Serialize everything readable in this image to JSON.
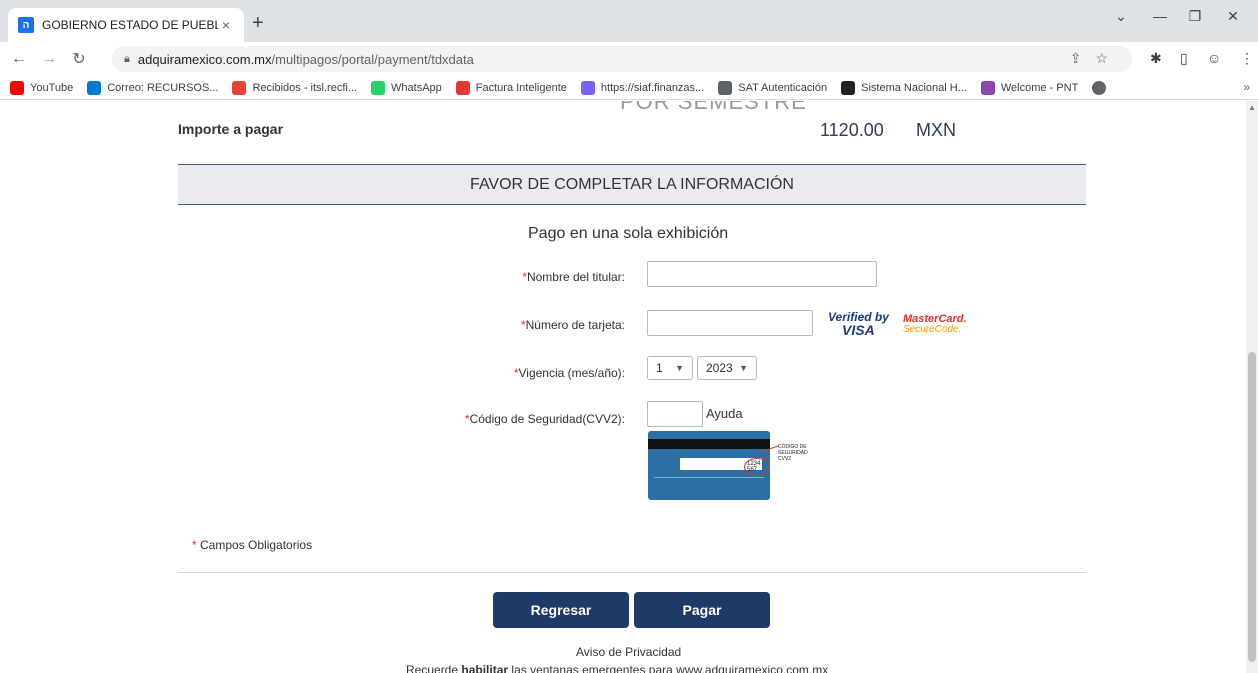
{
  "browser": {
    "tab_title": "GOBIERNO ESTADO DE PUEBLA",
    "tab_close": "×",
    "new_tab": "+",
    "url_domain": "adquiramexico.com.mx",
    "url_path": "/multipagos/portal/payment/tdxdata",
    "window_min": "—",
    "window_restore": "❐",
    "window_close": "✕",
    "window_dropdown": "⌄",
    "bookmarks": [
      {
        "label": "YouTube",
        "color": "#ff0000"
      },
      {
        "label": "Correo: RECURSOS...",
        "color": "#0078d4"
      },
      {
        "label": "Recibidos - itsl.recfi...",
        "color": "#ea4335"
      },
      {
        "label": "WhatsApp",
        "color": "#25d366"
      },
      {
        "label": "Factura Inteligente",
        "color": "#e53935"
      },
      {
        "label": "https://siaf.finanzas...",
        "color": "#7b61ff"
      },
      {
        "label": "SAT Autenticación",
        "color": "#5f6368"
      },
      {
        "label": "Sistema Nacional H...",
        "color": "#202124"
      },
      {
        "label": "Welcome - PNT",
        "color": "#8e44ad"
      }
    ],
    "bookmarks_more": "»"
  },
  "page": {
    "cut_heading": "POR SEMESTRE",
    "importe_label": "Importe a pagar",
    "importe_amount": "1120.00",
    "importe_currency": "MXN",
    "section_title": "FAVOR DE COMPLETAR LA INFORMACIÓN",
    "pay_mode": "Pago en una sola exhibición",
    "required_mark": "*",
    "fields": {
      "nombre_label": "Nombre del titular:",
      "nombre_value": "",
      "tarjeta_label": "Número de tarjeta:",
      "tarjeta_value": "",
      "vigencia_label": "Vigencia (mes/año):",
      "vigencia_month": "1",
      "vigencia_year": "2023",
      "cvv_label": "Código de Seguridad(CVV2):",
      "cvv_value": ""
    },
    "verified_line1": "Verified by",
    "verified_line2": "VISA",
    "mastercard_line1": "MasterCard.",
    "mastercard_line2": "SecureCode.",
    "ayuda": "Ayuda",
    "card_cvv_sample": "1234 567",
    "card_cvv_caption": "CÓDIGO DE SEGURIDAD CVV2",
    "obligatorios": "Campos Obligatorios",
    "btn_regresar": "Regresar",
    "btn_pagar": "Pagar",
    "aviso": "Aviso de Privacidad",
    "recuerde_pre": "Recuerde ",
    "recuerde_bold": "habilitar",
    "recuerde_post": " las ventanas emergentes para www.adquiramexico.com.mx"
  }
}
